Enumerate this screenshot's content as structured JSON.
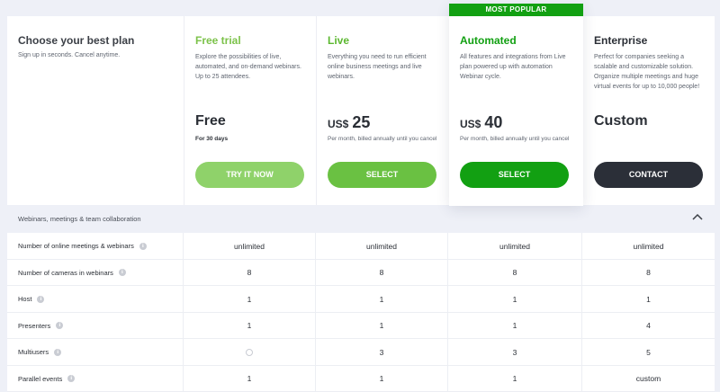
{
  "intro": {
    "title": "Choose your best plan",
    "subtitle": "Sign up in seconds. Cancel anytime."
  },
  "plans": [
    {
      "name": "Free trial",
      "name_color": "#7cc24a",
      "description": "Explore the possibilities of live, automated, and on-demand webinars. Up to 25 attendees.",
      "price": "Free",
      "price_note": "For 30 days",
      "button": "TRY IT NOW",
      "button_color": "#8fd26a"
    },
    {
      "name": "Live",
      "name_color": "#5cb830",
      "description": "Everything you need to run efficient online business meetings and live webinars.",
      "currency": "US$",
      "price": "25",
      "price_note": "Per month, billed annually until you cancel",
      "button": "SELECT",
      "button_color": "#6ac142"
    },
    {
      "name": "Automated",
      "name_color": "#12a012",
      "badge": "MOST POPULAR",
      "description": "All features and integrations from Live plan powered up with automation Webinar cycle.",
      "currency": "US$",
      "price": "40",
      "price_note": "Per month, billed annually until you cancel",
      "button": "SELECT",
      "button_color": "#12a012"
    },
    {
      "name": "Enterprise",
      "name_color": "#2b2f36",
      "description": "Perfect for companies seeking a scalable and customizable solution. Organize multiple meetings and huge virtual events for up to 10,000 people!",
      "price": "Custom",
      "button": "CONTACT",
      "button_color": "#2b2f38"
    }
  ],
  "section": {
    "label": "Webinars, meetings & team collaboration",
    "toggle_icon": "chevron-up-icon"
  },
  "features": [
    {
      "label": "Number of online meetings & webinars",
      "values": [
        "unlimited",
        "unlimited",
        "unlimited",
        "unlimited"
      ]
    },
    {
      "label": "Number of cameras in webinars",
      "values": [
        "8",
        "8",
        "8",
        "8"
      ]
    },
    {
      "label": "Host",
      "values": [
        "1",
        "1",
        "1",
        "1"
      ]
    },
    {
      "label": "Presenters",
      "values": [
        "1",
        "1",
        "1",
        "4"
      ]
    },
    {
      "label": "Multiusers",
      "values": [
        "",
        "3",
        "3",
        "5"
      ]
    },
    {
      "label": "Parallel events",
      "values": [
        "1",
        "1",
        "1",
        "custom"
      ]
    }
  ],
  "info_icon": "info-icon",
  "empty_icon": "circle-outline-icon"
}
